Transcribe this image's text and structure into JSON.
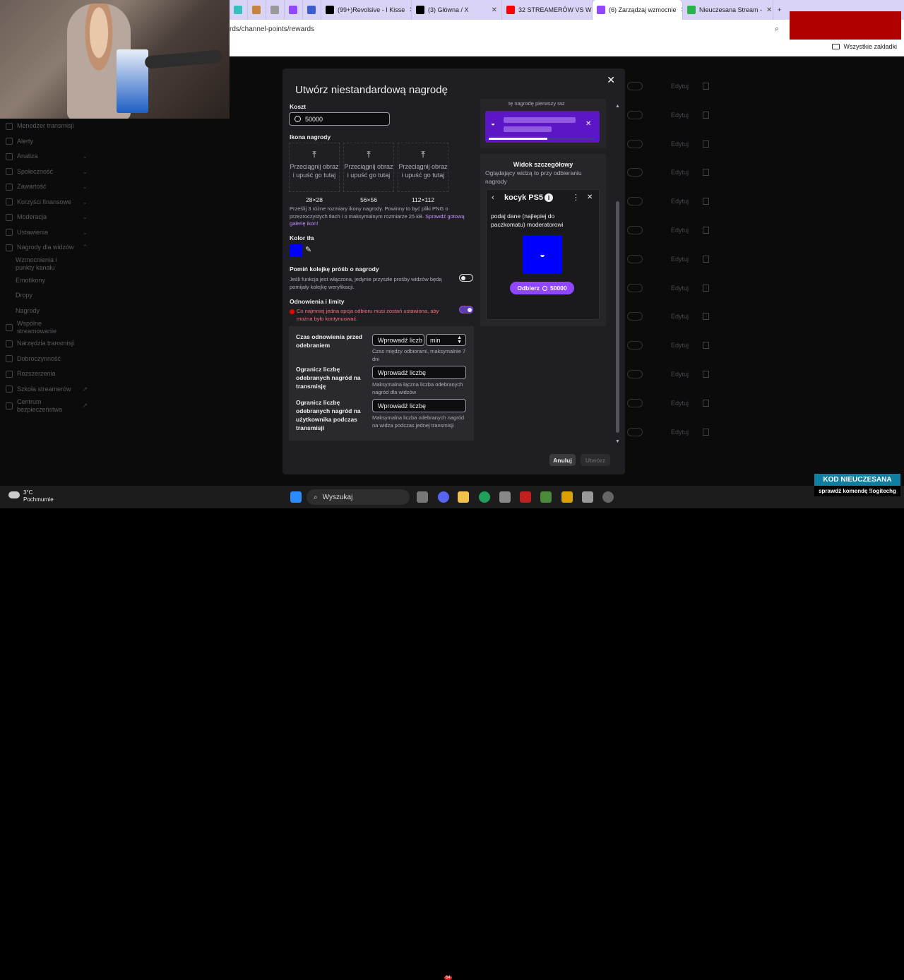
{
  "browser": {
    "tabs": [
      {
        "title": "",
        "color": "#35c0c0",
        "close": ""
      },
      {
        "title": "",
        "color": "#c68440",
        "close": ""
      },
      {
        "title": "",
        "color": "#999999",
        "close": ""
      },
      {
        "title": "",
        "color": "#9147ff",
        "close": ""
      },
      {
        "title": "",
        "color": "#3a5fcd",
        "close": ""
      },
      {
        "title": "(99+)Revolsive - I Kisse",
        "color": "#000000",
        "close": "✕"
      },
      {
        "title": "(3) Główna / X",
        "color": "#000000",
        "close": "✕"
      },
      {
        "title": "32 STREAMERÓW VS W",
        "color": "#ff0000",
        "close": "✕"
      },
      {
        "title": "(6) Zarządzaj wzmocnie",
        "color": "#9147ff",
        "close": "✕"
      },
      {
        "title": "Nieuczesana Stream -",
        "color": "#28b24a",
        "close": "✕"
      }
    ],
    "new_tab": "+",
    "url": "rds/channel-points/rewards",
    "all_bookmarks": "Wszystkie zakładki"
  },
  "sidebar": {
    "items": [
      {
        "label": "Menedżer transmisji",
        "chev": ""
      },
      {
        "label": "Alerty",
        "chev": ""
      },
      {
        "label": "Analiza",
        "chev": "⌄"
      },
      {
        "label": "Społeczność",
        "chev": "⌄"
      },
      {
        "label": "Zawartość",
        "chev": "⌄"
      },
      {
        "label": "Korzyści finansowe",
        "chev": "⌄"
      },
      {
        "label": "Moderacja",
        "chev": "⌄"
      },
      {
        "label": "Ustawienia",
        "chev": "⌄"
      },
      {
        "label": "Nagrody dla widzów",
        "chev": "⌃"
      },
      {
        "label": "Wzmocnienia i punkty kanału",
        "chev": ""
      },
      {
        "label": "Emotikony",
        "chev": ""
      },
      {
        "label": "Dropy",
        "chev": ""
      },
      {
        "label": "Nagrody",
        "chev": ""
      },
      {
        "label": "Wspólne streamowanie",
        "chev": ""
      },
      {
        "label": "Narzędzia transmisji",
        "chev": ""
      },
      {
        "label": "Dobroczynność",
        "chev": ""
      },
      {
        "label": "Rozszerzenia",
        "chev": ""
      },
      {
        "label": "Szkoła streamerów",
        "chev": "↗"
      },
      {
        "label": "Centrum bezpieczeństwa",
        "chev": "↗"
      }
    ],
    "edit_label": "Edytuj"
  },
  "modal": {
    "title": "Utwórz niestandardową nagrodę",
    "close": "✕",
    "cost_label": "Koszt",
    "cost_value": "50000",
    "icon_label": "Ikona nagrody",
    "drop_text": "Przeciągnij obraz i upuść go tutaj",
    "sizes": [
      "28×28",
      "56×56",
      "112×112"
    ],
    "icon_help": "Prześlij 3 różne rozmiary ikony nagrody. Powinny to być pliki PNG o przezroczystych tłach i o maksymalnym rozmiarze 25 kB.",
    "icon_help_link": "Sprawdź gotową galerię ikon!",
    "bg_color_label": "Kolor tła",
    "bg_color": "#0000ff",
    "skip_queue_label": "Pomiń kolejkę próśb o nagrody",
    "skip_queue_desc": "Jeśli funkcja jest włączona, jedynie przyszłe prośby widzów będą pomijały kolejkę weryfikacji.",
    "cooldown_label": "Odnowienia i limity",
    "error": "Co najmniej jedna opcja odbioru musi zostań ustawiona, aby można było kontynuować.",
    "cooldown_row": {
      "label": "Czas odnowienia przed odebraniem",
      "placeholder": "Wprowadź liczb",
      "unit": "min",
      "help": "Czas między odbiorami, maksymalnie 7 dni"
    },
    "limit_row": {
      "label": "Ogranicz liczbę odebranych nagród na transmisję",
      "placeholder": "Wprowadź liczbę",
      "help": "Maksymalna łączna liczba odebranych nagród dla widzów"
    },
    "user_limit_row": {
      "label": "Ogranicz liczbę odebranych nagród na użytkownika podczas transmisji",
      "placeholder": "Wprowadź liczbę",
      "help": "Maksymalna liczba odebranych nagród na widza podczas jednej transmisji"
    },
    "cancel": "Anuluj",
    "create": "Utwórz"
  },
  "preview": {
    "top_caption": "tę nagrodę pierwszy raz",
    "notice_progress": 0.55,
    "detail_title": "Widok szczegółowy",
    "detail_desc": "Oglądający widzą to przy odbieraniu nagrody",
    "reward_name": "kocyk PS5",
    "reward_prompt": "podaj dane (najlepiej do paczkomatu) moderatorowi",
    "claim_label": "Odbierz",
    "claim_cost": "50000"
  },
  "taskbar": {
    "temp": "3°C",
    "weather": "Pochmurnie",
    "search": "Wyszukaj",
    "discord_badge": "64"
  },
  "overlay": {
    "title": "KOD NIEUCZESANA",
    "subtitle": "sprawdź komendę !logitechg"
  }
}
